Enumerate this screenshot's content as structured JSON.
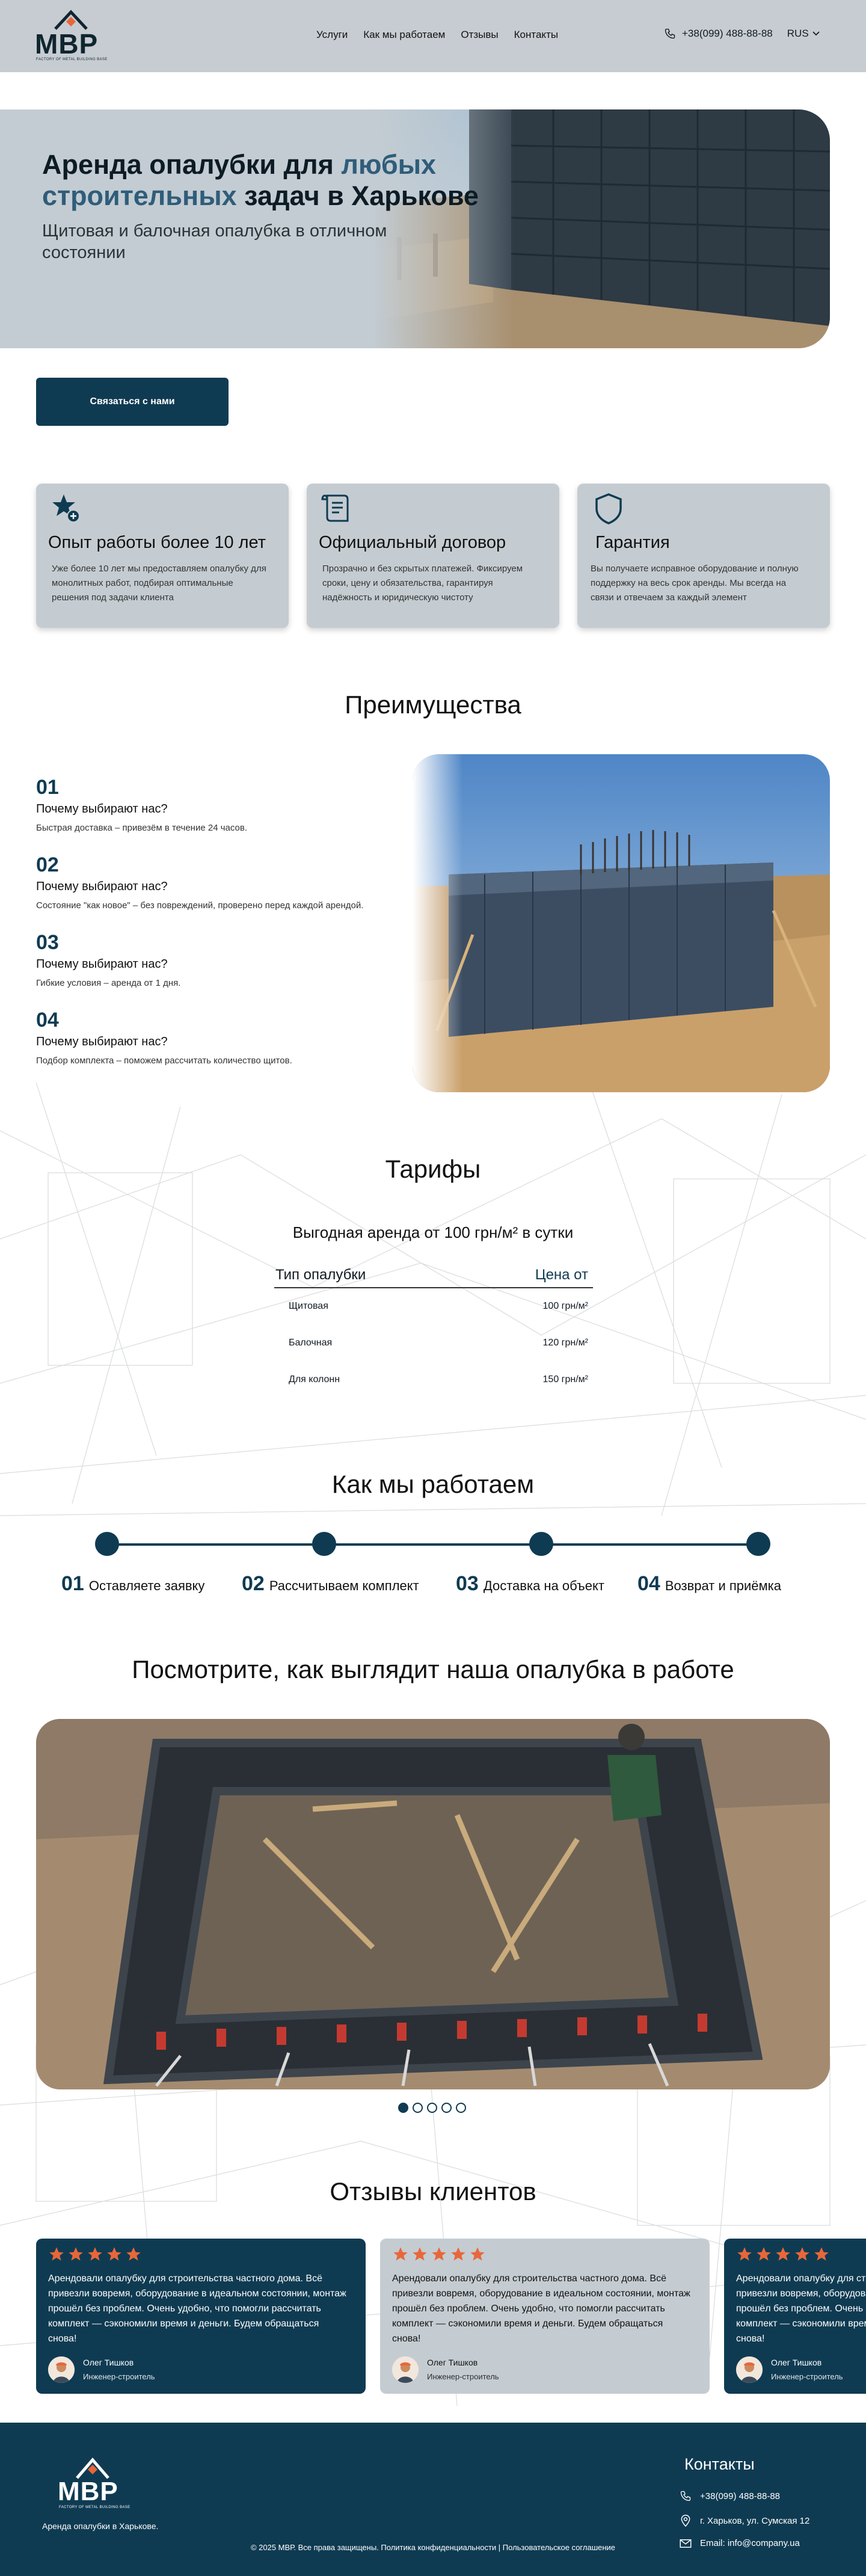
{
  "brand": {
    "logo_text": "МВР",
    "logo_sub": "FACTORY OF METAL BUILDING BASE"
  },
  "header": {
    "nav": [
      "Услуги",
      "Как мы работаем",
      "Отзывы",
      "Контакты"
    ],
    "phone": "+38(099) 488-88-88",
    "lang": "RUS"
  },
  "hero": {
    "title_1": "Аренда опалубки для ",
    "title_accent": "любых строительных",
    "title_2": " задач в Харькове",
    "subtitle": "Щитовая и балочная опалубка в отличном состоянии",
    "cta": "Связаться с нами"
  },
  "features": [
    {
      "icon": "star-badge-icon",
      "title": "Опыт работы более 10 лет",
      "text": "Уже более 10 лет мы предоставляем опалубку для монолитных работ, подбирая оптимальные решения под задачи клиента"
    },
    {
      "icon": "document-icon",
      "title": "Официальный договор",
      "text": "Прозрачно и без скрытых платежей. Фиксируем сроки, цену и обязательства, гарантируя надёжность и юридическую чистоту"
    },
    {
      "icon": "shield-icon",
      "title": "Гарантия",
      "text": "Вы получаете исправное оборудование и полную поддержку на весь срок аренды. Мы всегда на связи и отвечаем за каждый элемент"
    }
  ],
  "advantages": {
    "title": "Преимущества",
    "items": [
      {
        "num": "01",
        "q": "Почему выбирают нас?",
        "d": "Быстрая доставка – привезём в течение 24 часов."
      },
      {
        "num": "02",
        "q": "Почему выбирают нас?",
        "d": "Состояние \"как новое\" – без повреждений, проверено перед каждой арендой."
      },
      {
        "num": "03",
        "q": "Почему выбирают нас?",
        "d": "Гибкие условия – аренда от 1 дня."
      },
      {
        "num": "04",
        "q": "Почему выбирают нас?",
        "d": "Подбор комплекта – поможем рассчитать количество щитов."
      }
    ]
  },
  "tariffs": {
    "title": "Тарифы",
    "subtitle": "Выгодная аренда от 100 грн/м² в сутки",
    "col_type": "Тип опалубки",
    "col_price": "Цена от",
    "rows": [
      {
        "type": "Щитовая",
        "price": "100 грн/м²"
      },
      {
        "type": "Балочная",
        "price": "120 грн/м²"
      },
      {
        "type": "Для колонн",
        "price": "150 грн/м²"
      }
    ]
  },
  "steps": {
    "title": "Как мы работаем",
    "items": [
      {
        "num": "01",
        "label": "Оставляете заявку"
      },
      {
        "num": "02",
        "label": "Рассчитываем комплект"
      },
      {
        "num": "03",
        "label": "Доставка на объект"
      },
      {
        "num": "04",
        "label": "Возврат и приёмка"
      }
    ]
  },
  "gallery": {
    "title": "Посмотрите, как выглядит наша опалубка в работе",
    "active_slide": 1,
    "slides": 5
  },
  "reviews": {
    "title": "Отзывы клиентов",
    "items": [
      {
        "rating": 5,
        "text": "Арендовали опалубку для строительства частного дома. Всё привезли вовремя, оборудование в идеальном состоянии, монтаж прошёл без проблем. Очень удобно, что помогли рассчитать комплект — сэкономили время и деньги. Будем обращаться снова!",
        "name": "Олег Тишков",
        "role": "Инженер-строитель"
      },
      {
        "rating": 5,
        "text": "Арендовали опалубку для строительства частного дома. Всё привезли вовремя, оборудование в идеальном состоянии, монтаж прошёл без проблем. Очень удобно, что помогли рассчитать комплект — сэкономили время и деньги. Будем обращаться снова!",
        "name": "Олег Тишков",
        "role": "Инженер-строитель"
      },
      {
        "rating": 5,
        "text": "Арендовали опалубку для строительства частного дома. Всё привезли вовремя, оборудование в идеальном состоянии, монтаж прошёл без проблем. Очень удобно, что помогли рассчитать комплект — сэкономили время и деньги. Будем обращаться снова!",
        "name": "Олег Тишков",
        "role": "Инженер-строитель"
      }
    ]
  },
  "footer": {
    "tagline": "Аренда опалубки в Харькове.",
    "copyright": "© 2025 МВР. Все права защищены.   Политика конфиденциальности | Пользовательское соглашение",
    "contacts_title": "Контакты",
    "phone": "+38(099) 488-88-88",
    "address": "г. Харьков, ул. Сумская 12",
    "email": "Email: info@company.ua"
  },
  "colors": {
    "primary": "#0f3b52",
    "header_bg": "#c6ccd1",
    "card_bg": "#c5ccd1",
    "star": "#e8673a",
    "accent_text": "#2f5d7a"
  }
}
